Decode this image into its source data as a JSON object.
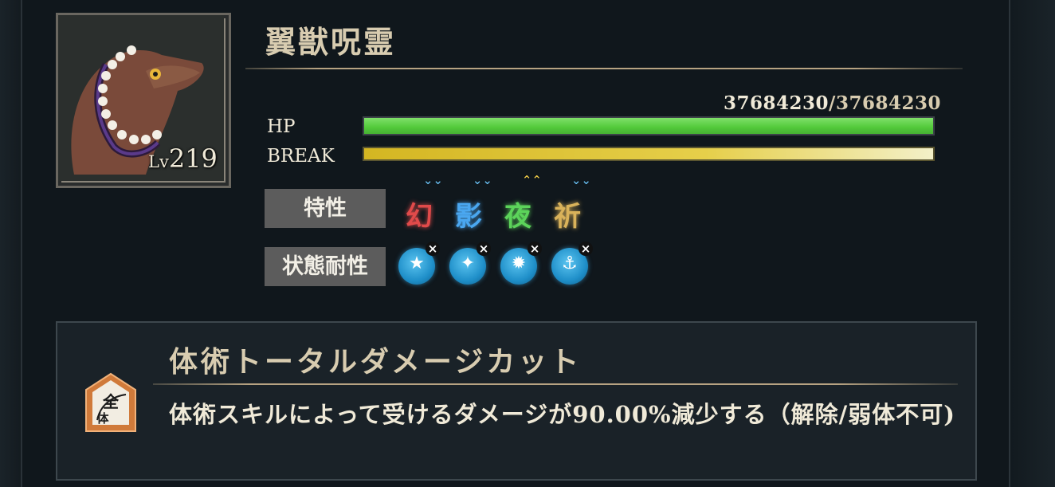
{
  "enemy": {
    "name": "翼獣呪霊",
    "level_prefix": "Lv",
    "level": "219"
  },
  "stats": {
    "hp_label": "HP",
    "hp_current": "37684230",
    "hp_separator": "/",
    "hp_max": "37684230",
    "hp_fill_fraction": 1.0,
    "break_label": "BREAK",
    "break_fill_fraction": 1.0
  },
  "traits": {
    "label": "特性",
    "items": [
      {
        "glyph": "幻",
        "color": "#e04a4a",
        "marker": "⌄⌄",
        "marker_color": "#6ec9ff",
        "icon": "illusion-trait-icon"
      },
      {
        "glyph": "影",
        "color": "#4aa7f0",
        "marker": "⌄⌄",
        "marker_color": "#6ec9ff",
        "icon": "shadow-trait-icon"
      },
      {
        "glyph": "夜",
        "color": "#5cd35a",
        "marker": "⌃⌃",
        "marker_color": "#ffd84a",
        "icon": "night-trait-icon"
      },
      {
        "glyph": "祈",
        "color": "#d9b25a",
        "marker": "⌄⌄",
        "marker_color": "#6ec9ff",
        "icon": "prayer-trait-icon"
      }
    ]
  },
  "status_resist": {
    "label": "状態耐性",
    "items": [
      {
        "symbol": "★",
        "icon": "stun-resist-icon",
        "mark": "×"
      },
      {
        "symbol": "✦",
        "icon": "confuse-resist-icon",
        "mark": "×"
      },
      {
        "symbol": "✹",
        "icon": "poison-resist-icon",
        "mark": "×"
      },
      {
        "symbol": "⚓",
        "icon": "bind-resist-icon",
        "mark": "×"
      }
    ]
  },
  "skill": {
    "badge_top": "全",
    "badge_bottom": "体",
    "title": "体術トータルダメージカット",
    "description": "体術スキルによって受けるダメージが90.00%減少する（解除/弱体不可)"
  },
  "colors": {
    "hp_bar": "#5fd24a",
    "break_bar": "#e2c93a",
    "accent_gold": "#b7a382",
    "resist_blue": "#2a9be0"
  }
}
